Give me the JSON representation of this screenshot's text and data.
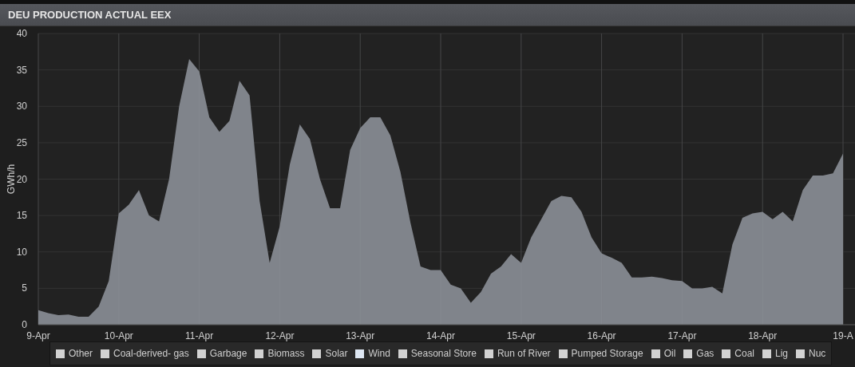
{
  "panel": {
    "title": "DEU PRODUCTION ACTUAL EEX",
    "chart_data": {
      "type": "area",
      "grid": true,
      "ylabel": "GWh/h",
      "ylim": [
        0,
        40
      ],
      "yticks": [
        0,
        5,
        10,
        15,
        20,
        25,
        30,
        35,
        40
      ],
      "categories": [
        "9-Apr",
        null,
        null,
        null,
        null,
        null,
        null,
        null,
        "10-Apr",
        null,
        null,
        null,
        null,
        null,
        null,
        null,
        "11-Apr",
        null,
        null,
        null,
        null,
        null,
        null,
        null,
        "12-Apr",
        null,
        null,
        null,
        null,
        null,
        null,
        null,
        "13-Apr",
        null,
        null,
        null,
        null,
        null,
        null,
        null,
        "14-Apr",
        null,
        null,
        null,
        null,
        null,
        null,
        null,
        "15-Apr",
        null,
        null,
        null,
        null,
        null,
        null,
        null,
        "16-Apr",
        null,
        null,
        null,
        null,
        null,
        null,
        null,
        "17-Apr",
        null,
        null,
        null,
        null,
        null,
        null,
        null,
        "18-Apr",
        null,
        null,
        null,
        null,
        null,
        null,
        null,
        "19-A"
      ],
      "series": [
        {
          "color": "#80848b",
          "values": [
            2,
            1.6,
            1.3,
            1.4,
            1.1,
            1.1,
            2.5,
            6,
            15.3,
            16.5,
            18.5,
            15,
            14.2,
            20,
            30,
            36.5,
            34.8,
            28.5,
            26.5,
            28,
            33.5,
            31.5,
            17,
            8.5,
            13.5,
            22,
            27.5,
            25.5,
            20,
            16,
            16,
            24,
            27,
            28.5,
            28.5,
            26,
            21,
            14,
            8,
            7.5,
            7.5,
            5.5,
            5,
            3,
            4.5,
            7,
            8,
            9.7,
            8.5,
            12,
            14.5,
            17,
            17.7,
            17.5,
            15.5,
            12,
            9.8,
            9.2,
            8.5,
            6.5,
            6.5,
            6.6,
            6.4,
            6.1,
            6,
            5,
            5,
            5.2,
            4.3,
            11,
            14.7,
            15.3,
            15.5,
            14.5,
            15.5,
            14.2,
            18.5,
            20.5,
            20.5,
            20.8,
            23.5
          ]
        }
      ]
    }
  },
  "legend": [
    {
      "label": "Other",
      "color": "#d2d2d2"
    },
    {
      "label": "Coal-derived- gas",
      "color": "#d2d2d2"
    },
    {
      "label": "Garbage",
      "color": "#d2d2d2"
    },
    {
      "label": "Biomass",
      "color": "#d2d2d2"
    },
    {
      "label": "Solar",
      "color": "#d2d2d2"
    },
    {
      "label": "Wind",
      "color": "#dde6f2"
    },
    {
      "label": "Seasonal Store",
      "color": "#d2d2d2"
    },
    {
      "label": "Run of River",
      "color": "#d2d2d2"
    },
    {
      "label": "Pumped Storage",
      "color": "#d2d2d2"
    },
    {
      "label": "Oil",
      "color": "#d2d2d2"
    },
    {
      "label": "Gas",
      "color": "#d2d2d2"
    },
    {
      "label": "Coal",
      "color": "#d2d2d2"
    },
    {
      "label": "Lig",
      "color": "#d2d2d2"
    },
    {
      "label": "Nuc",
      "color": "#d2d2d2"
    }
  ]
}
